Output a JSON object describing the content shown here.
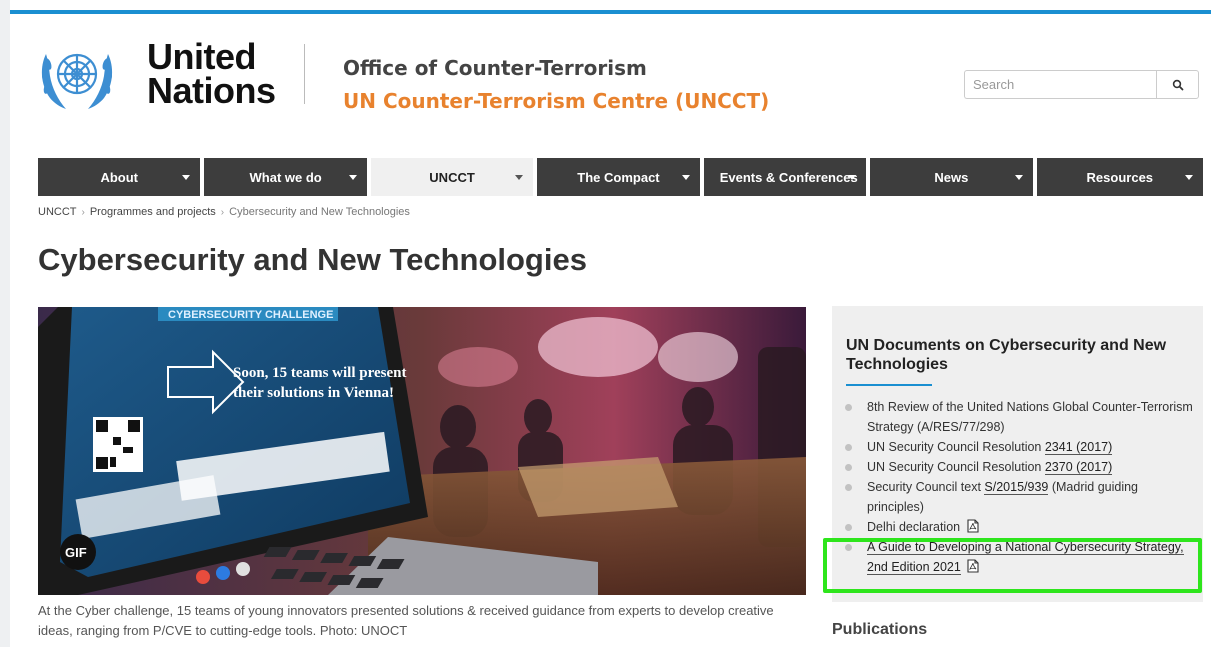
{
  "header": {
    "org_line1": "United",
    "org_line2": "Nations",
    "office_title": "Office of Counter-Terrorism",
    "office_subtitle": "UN Counter-Terrorism Centre (UNCCT)",
    "search_placeholder": "Search",
    "icons": {
      "logo": "un-emblem",
      "search": "search-icon"
    }
  },
  "nav": {
    "items": [
      {
        "label": "About",
        "active": false
      },
      {
        "label": "What we do",
        "active": false
      },
      {
        "label": "UNCCT",
        "active": true
      },
      {
        "label": "The Compact",
        "active": false
      },
      {
        "label": "Events & Conferences",
        "active": false
      },
      {
        "label": "News",
        "active": false
      },
      {
        "label": "Resources",
        "active": false
      }
    ]
  },
  "breadcrumb": {
    "items": [
      "UNCCT",
      "Programmes and projects",
      "Cybersecurity and New Technologies"
    ],
    "separator": "›"
  },
  "page": {
    "title": "Cybersecurity and New Technologies",
    "hero": {
      "screen_banner": "CYBERSECURITY CHALLENGE",
      "screen_text_1": "Soon, 15 teams will present",
      "screen_text_2": "their solutions in Vienna!",
      "gif_badge": "GIF"
    },
    "caption": "At the Cyber challenge, 15 teams of young innovators presented solutions & received guidance from experts to develop creative ideas, ranging from P/CVE to cutting-edge tools. Photo: UNOCT"
  },
  "sidebar": {
    "title": "UN Documents on Cybersecurity and New Technologies",
    "items": [
      {
        "pre": "8th Review of the United Nations Global Counter-Terrorism Strategy (A/RES/77/298)",
        "link": "",
        "post": "",
        "pdf": false
      },
      {
        "pre": "UN Security Council Resolution ",
        "link": "2341 (2017)",
        "post": "",
        "pdf": false
      },
      {
        "pre": "UN Security Council Resolution ",
        "link": "2370 (2017)",
        "post": "",
        "pdf": false
      },
      {
        "pre": "Security Council text ",
        "link": "S/2015/939",
        "post": " (Madrid guiding principles)",
        "pdf": false
      },
      {
        "pre": "Delhi declaration",
        "link": "",
        "post": "",
        "pdf": true
      },
      {
        "pre": "",
        "link": "A Guide to Developing a National Cybersecurity Strategy, 2nd Edition 2021",
        "post": "",
        "pdf": true,
        "highlighted": true
      }
    ],
    "publications_heading": "Publications"
  },
  "colors": {
    "accent_blue": "#1a8fd1",
    "orange": "#e8822e",
    "nav_dark": "#3d3d3d",
    "highlight_green": "#2ee51c"
  }
}
